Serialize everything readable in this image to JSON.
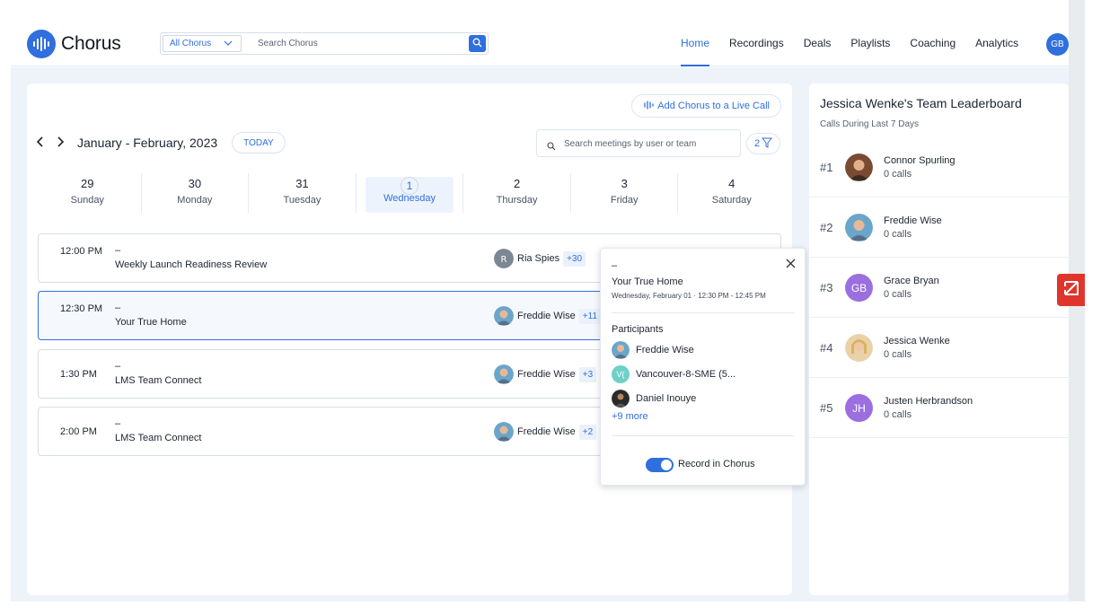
{
  "app": {
    "name": "Chorus",
    "colors": {
      "accent": "#2f6fde",
      "badge": "#e0352b"
    }
  },
  "search": {
    "scope": "All Chorus",
    "placeholder": "Search Chorus"
  },
  "nav": {
    "items": [
      "Home",
      "Recordings",
      "Deals",
      "Playlists",
      "Coaching",
      "Analytics"
    ],
    "active": "Home"
  },
  "user": {
    "initials": "GB"
  },
  "calendar": {
    "live_call_label": "Add Chorus to a Live Call",
    "range_label": "January - February, 2023",
    "today_label": "TODAY",
    "meeting_search_placeholder": "Search meetings by user or team",
    "filter_count": "2",
    "days": [
      {
        "num": "29",
        "name": "Sunday"
      },
      {
        "num": "30",
        "name": "Monday"
      },
      {
        "num": "31",
        "name": "Tuesday"
      },
      {
        "num": "1",
        "name": "Wednesday"
      },
      {
        "num": "2",
        "name": "Thursday"
      },
      {
        "num": "3",
        "name": "Friday"
      },
      {
        "num": "4",
        "name": "Saturday"
      }
    ],
    "meetings": [
      {
        "time": "12:00 PM",
        "dash": "–",
        "title": "Weekly Launch Readiness Review",
        "owner": "Ria Spies",
        "extra": "+30"
      },
      {
        "time": "12:30 PM",
        "dash": "–",
        "title": "Your True Home",
        "owner": "Freddie Wise",
        "extra": "+11"
      },
      {
        "time": "1:30 PM",
        "dash": "–",
        "title": "LMS Team Connect",
        "owner": "Freddie Wise",
        "extra": "+3"
      },
      {
        "time": "2:00 PM",
        "dash": "–",
        "title": "LMS Team Connect",
        "owner": "Freddie Wise",
        "extra": "+2"
      }
    ]
  },
  "popover": {
    "dash": "–",
    "title": "Your True Home",
    "when": "Wednesday, February 01 · 12:30 PM - 12:45 PM",
    "participants_heading": "Participants",
    "participants": [
      {
        "name": "Freddie Wise"
      },
      {
        "name": "Vancouver-8-SME (5...",
        "initials": "V("
      },
      {
        "name": "Daniel Inouye"
      }
    ],
    "more": "+9 more",
    "record_label": "Record in Chorus"
  },
  "leaderboard": {
    "title": "Jessica Wenke's Team Leaderboard",
    "subtitle": "Calls During Last 7 Days",
    "rows": [
      {
        "rank": "#1",
        "name": "Connor Spurling",
        "calls": "0 calls"
      },
      {
        "rank": "#2",
        "name": "Freddie Wise",
        "calls": "0 calls"
      },
      {
        "rank": "#3",
        "name": "Grace Bryan",
        "calls": "0 calls",
        "initials": "GB"
      },
      {
        "rank": "#4",
        "name": "Jessica Wenke",
        "calls": "0 calls"
      },
      {
        "rank": "#5",
        "name": "Justen Herbrandson",
        "calls": "0 calls",
        "initials": "JH"
      }
    ]
  }
}
